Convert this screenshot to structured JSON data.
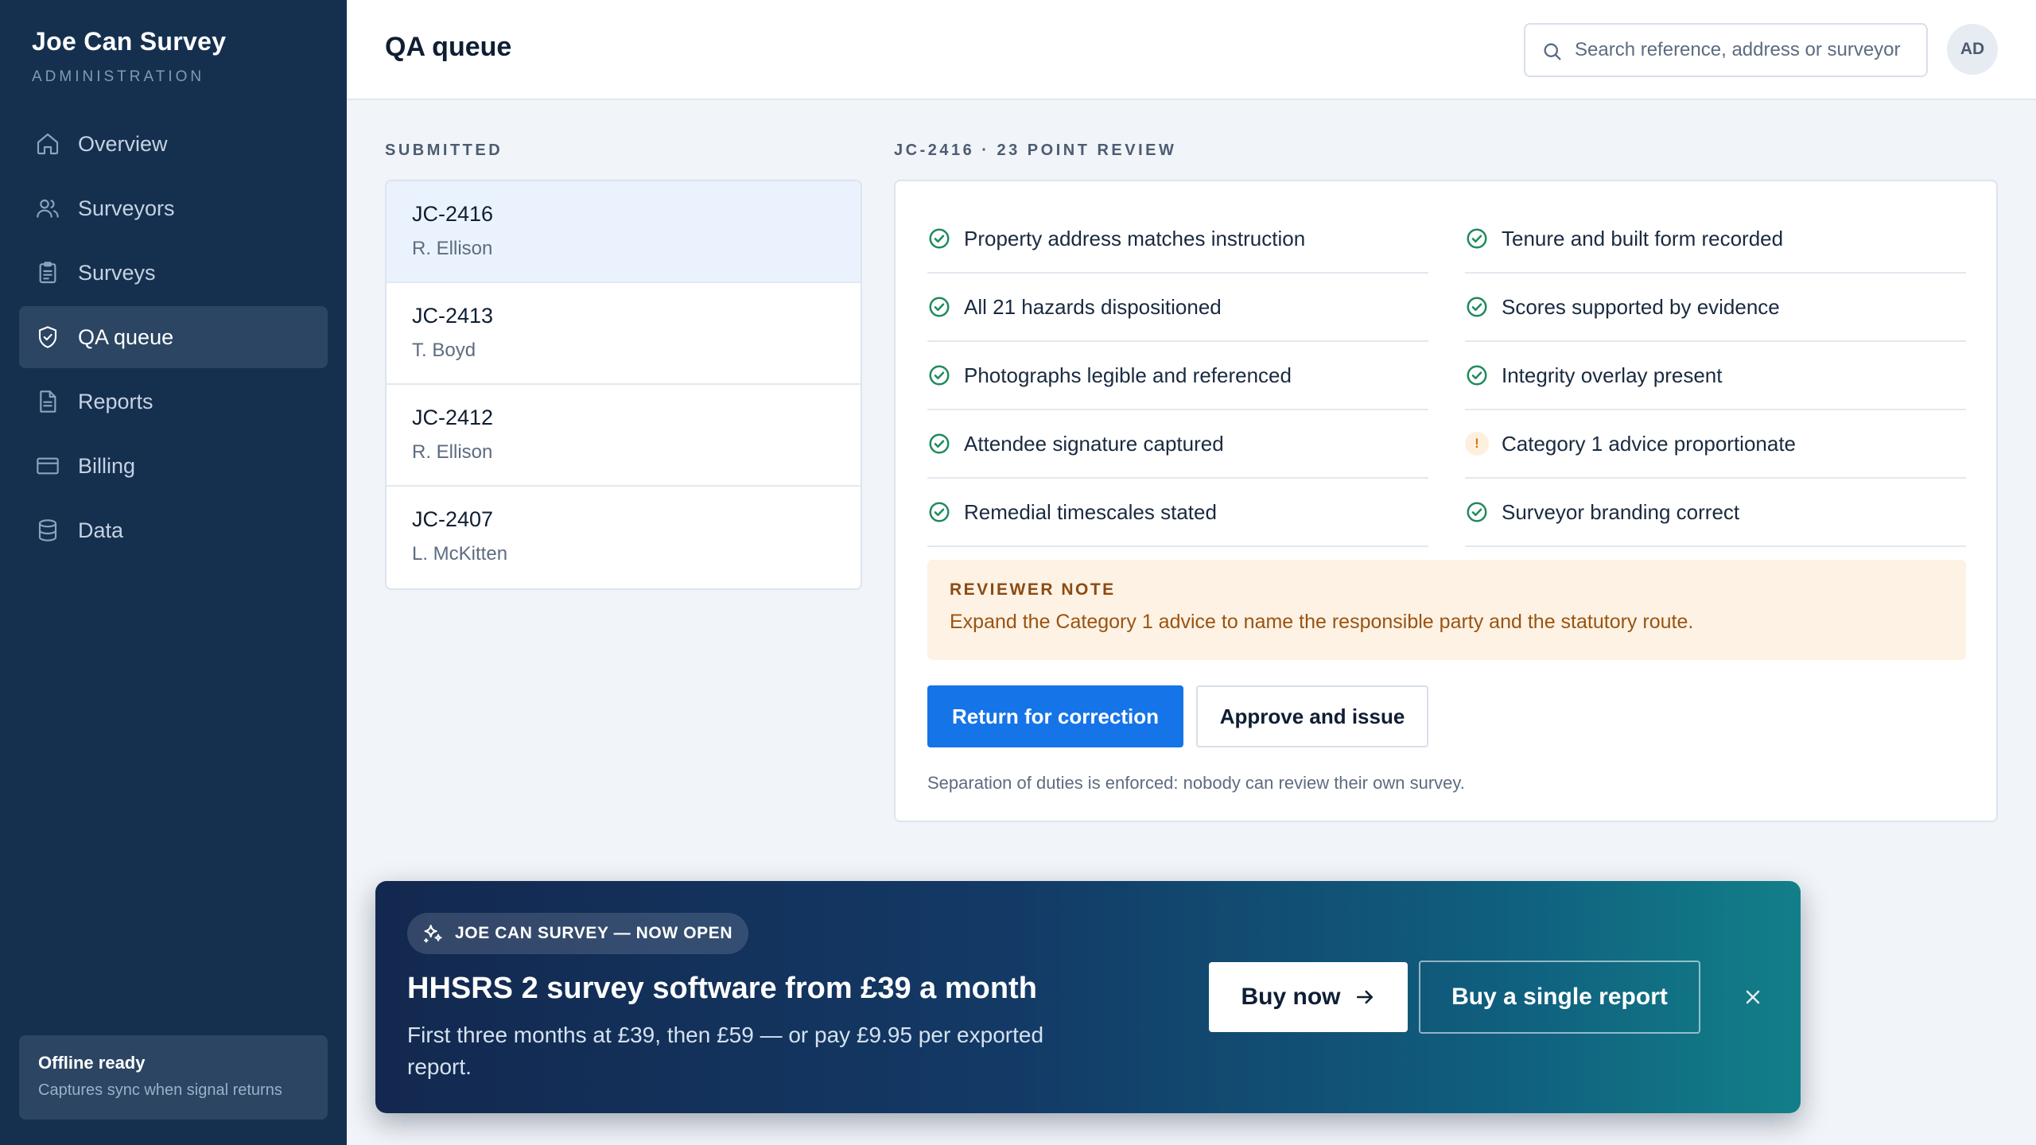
{
  "sidebar": {
    "brand": "Joe Can Survey",
    "subtitle": "ADMINISTRATION",
    "items": [
      {
        "label": "Overview",
        "icon": "home-icon"
      },
      {
        "label": "Surveyors",
        "icon": "users-icon"
      },
      {
        "label": "Surveys",
        "icon": "clipboard-icon"
      },
      {
        "label": "QA queue",
        "icon": "shield-check-icon",
        "active": true
      },
      {
        "label": "Reports",
        "icon": "document-icon"
      },
      {
        "label": "Billing",
        "icon": "credit-card-icon"
      },
      {
        "label": "Data",
        "icon": "database-icon"
      }
    ],
    "status": {
      "title": "Offline ready",
      "subtitle": "Captures sync when signal returns"
    }
  },
  "header": {
    "title": "QA queue",
    "search_placeholder": "Search reference, address or surveyor",
    "avatar_initials": "AD"
  },
  "submitted": {
    "label": "SUBMITTED",
    "items": [
      {
        "ref": "JC-2416",
        "name": "R. Ellison",
        "selected": true
      },
      {
        "ref": "JC-2413",
        "name": "T. Boyd"
      },
      {
        "ref": "JC-2412",
        "name": "R. Ellison"
      },
      {
        "ref": "JC-2407",
        "name": "L. McKitten"
      }
    ]
  },
  "review": {
    "label": "JC-2416 · 23 POINT REVIEW",
    "checks_left": [
      {
        "label": "Property address matches instruction",
        "status": "pass"
      },
      {
        "label": "All 21 hazards dispositioned",
        "status": "pass"
      },
      {
        "label": "Photographs legible and referenced",
        "status": "pass"
      },
      {
        "label": "Attendee signature captured",
        "status": "pass"
      },
      {
        "label": "Remedial timescales stated",
        "status": "pass"
      }
    ],
    "checks_right": [
      {
        "label": "Tenure and built form recorded",
        "status": "pass"
      },
      {
        "label": "Scores supported by evidence",
        "status": "pass"
      },
      {
        "label": "Integrity overlay present",
        "status": "pass"
      },
      {
        "label": "Category 1 advice proportionate",
        "status": "warning"
      },
      {
        "label": "Surveyor branding correct",
        "status": "pass"
      }
    ],
    "warning_glyph": "!",
    "note": {
      "title": "REVIEWER NOTE",
      "text": "Expand the Category 1 advice to name the responsible party and the statutory route."
    },
    "return_label": "Return for correction",
    "approve_label": "Approve and issue",
    "duties_text": "Separation of duties is enforced: nobody can review their own survey."
  },
  "promo": {
    "pill": "JOE CAN SURVEY — NOW OPEN",
    "title": "HHSRS 2 survey software from £39 a month",
    "subtitle": "First three months at £39, then £59 — or pay £9.95 per exported report.",
    "buy_label": "Buy now",
    "single_label": "Buy a single report"
  },
  "colors": {
    "sidebar_bg": "#15304f",
    "primary": "#1574e8",
    "pass": "#1f8a5b",
    "warning": "#d97706",
    "note_bg": "#fdf2e4"
  }
}
